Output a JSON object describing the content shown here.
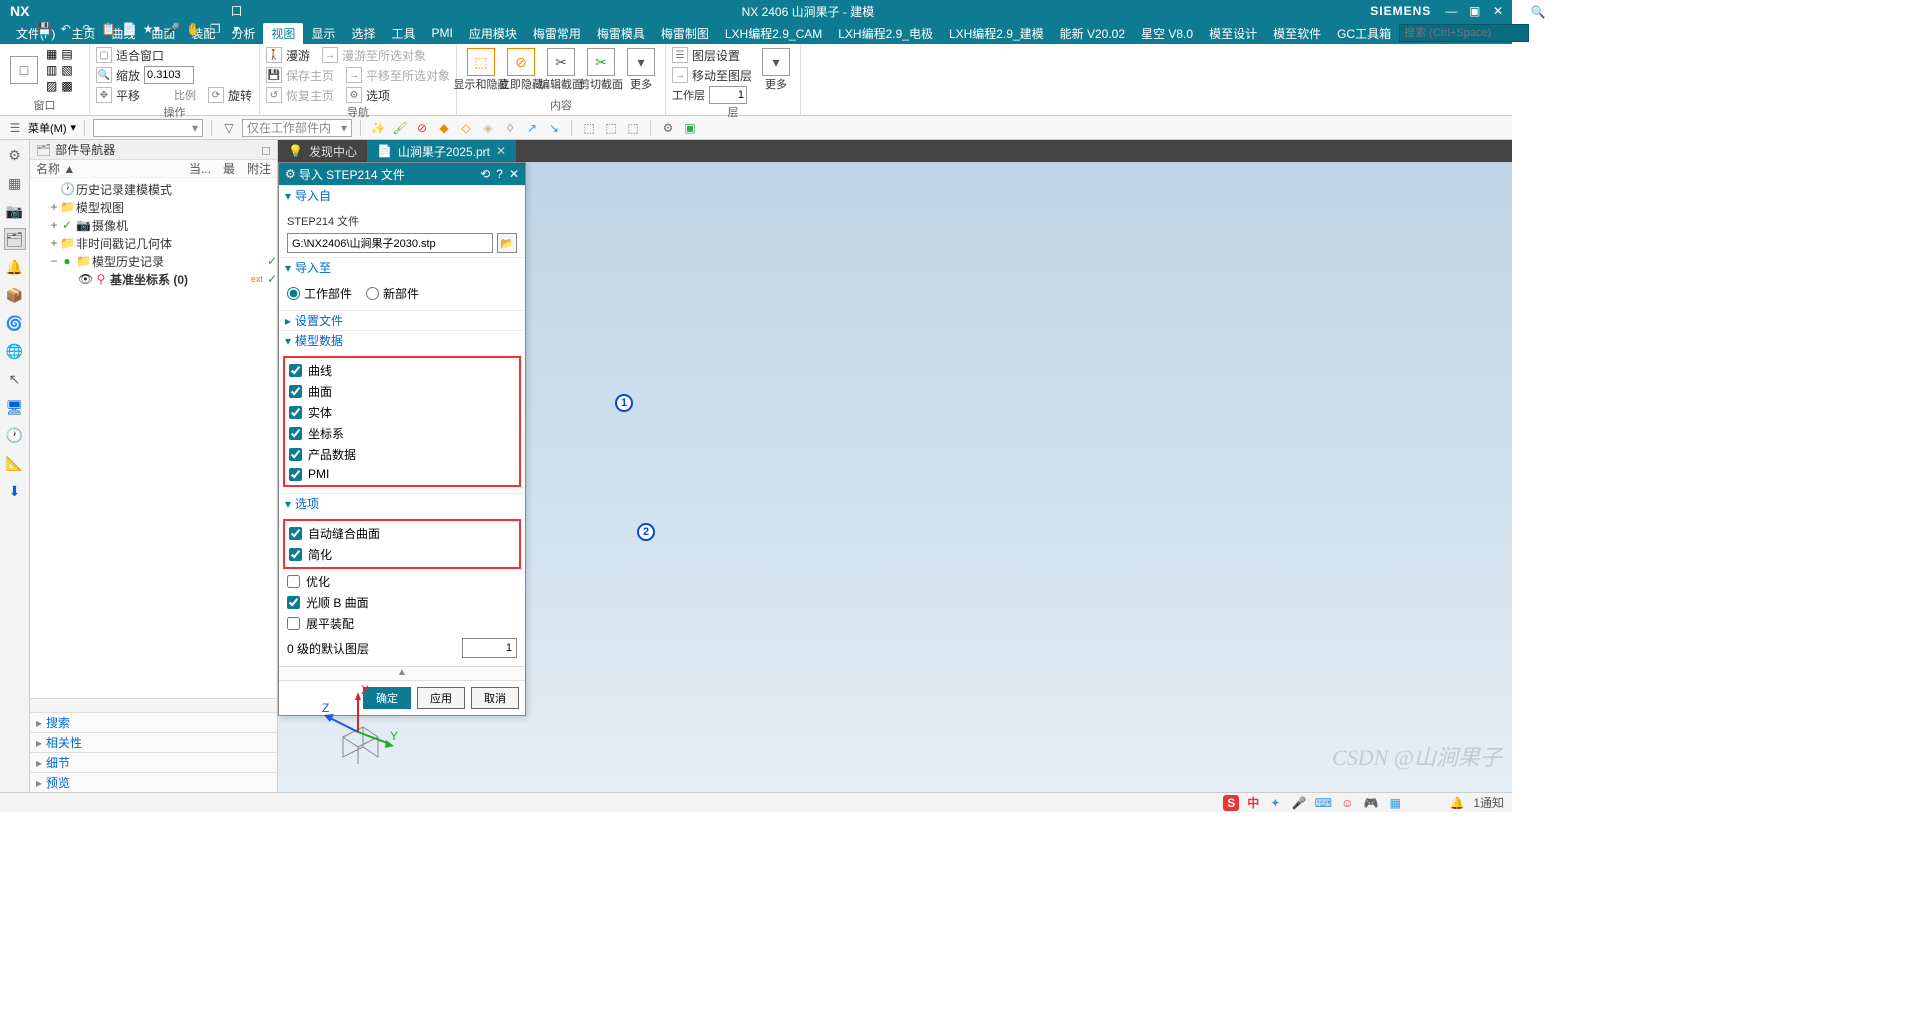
{
  "titlebar": {
    "nx": "NX",
    "title": "NX 2406 山涧果子 - 建模",
    "siemens": "SIEMENS"
  },
  "menubar": {
    "items": [
      "文件(F)",
      "主页",
      "曲线",
      "曲面",
      "装配",
      "分析",
      "视图",
      "显示",
      "选择",
      "工具",
      "PMI",
      "应用模块",
      "梅雷常用",
      "梅雷模具",
      "梅雷制图",
      "LXH编程2.9_CAM",
      "LXH编程2.9_电极",
      "LXH编程2.9_建模",
      "能新 V20.02",
      "星空 V8.0",
      "模至设计",
      "模至软件",
      "GC工具箱"
    ],
    "active_index": 6,
    "search_placeholder": "搜索 (Ctrl+Space)"
  },
  "ribbon": {
    "groups": {
      "window": {
        "label": "窗口",
        "big": ""
      },
      "ops": {
        "label": "操作",
        "fit_window": "适合窗口",
        "pan": "平移",
        "zoom": "缩放",
        "zoom_value": "0.3103",
        "ratio": "比例",
        "rotate": "旋转"
      },
      "nav": {
        "label": "导航",
        "roam": "漫游",
        "save_main": "保存主页",
        "restore_main": "恢复主页",
        "roam_to_sel": "漫游至所选对象",
        "pan_to_sel": "平移至所选对象",
        "options": "选项"
      },
      "content": {
        "label": "内容",
        "show_hide": "显示和隐藏",
        "immediate_hide": "立即隐藏",
        "edit_section": "编辑截面",
        "clip_section": "剪切截面",
        "more": "更多"
      },
      "layer": {
        "label": "层",
        "layer_settings": "图层设置",
        "move_to_layer": "移动至图层",
        "worklayer": "工作层",
        "worklayer_value": "1",
        "more": "更多"
      }
    }
  },
  "toolbar2": {
    "menu": "菜单(M)",
    "dd1": "",
    "dd2": "仅在工作部件内"
  },
  "nav": {
    "title": "部件导航器",
    "cols": {
      "name": "名称 ▲",
      "cur": "当...",
      "up": "最",
      "note": "附注"
    },
    "tree": {
      "n0": "历史记录建模模式",
      "n1": "模型视图",
      "n2": "摄像机",
      "n3": "非时间戳记几何体",
      "n4": "模型历史记录",
      "n5": "基准坐标系 (0)"
    },
    "acc": {
      "search": "搜索",
      "related": "相关性",
      "detail": "细节",
      "preview": "预览"
    }
  },
  "ws_tabs": {
    "discovery": "发现中心",
    "file": "山涧果子2025.prt"
  },
  "dialog": {
    "title": "导入 STEP214 文件",
    "sec_import_from": "导入自",
    "file_label": "STEP214 文件",
    "file_value": "G:\\NX2406\\山涧果子2030.stp",
    "sec_import_to": "导入至",
    "radio_work": "工作部件",
    "radio_new": "新部件",
    "sec_settings": "设置文件",
    "sec_model_data": "模型数据",
    "chk_curve": "曲线",
    "chk_surface": "曲面",
    "chk_solid": "实体",
    "chk_csys": "坐标系",
    "chk_product": "产品数据",
    "chk_pmi": "PMI",
    "sec_options": "选项",
    "chk_autosew": "自动缝合曲面",
    "chk_simplify": "简化",
    "chk_optimize": "优化",
    "chk_smoothb": "光顺 B 曲面",
    "chk_flatten": "展平装配",
    "default_layer_label": "0 级的默认图层",
    "default_layer_value": "1",
    "ok": "确定",
    "apply": "应用",
    "cancel": "取消"
  },
  "annot": {
    "a1": "1",
    "a2": "2"
  },
  "triad": {
    "x": "X",
    "y": "Y",
    "z": "Z"
  },
  "watermark": "CSDN @山涧果子",
  "status": {
    "zhong": "中",
    "notify": "1通知"
  }
}
